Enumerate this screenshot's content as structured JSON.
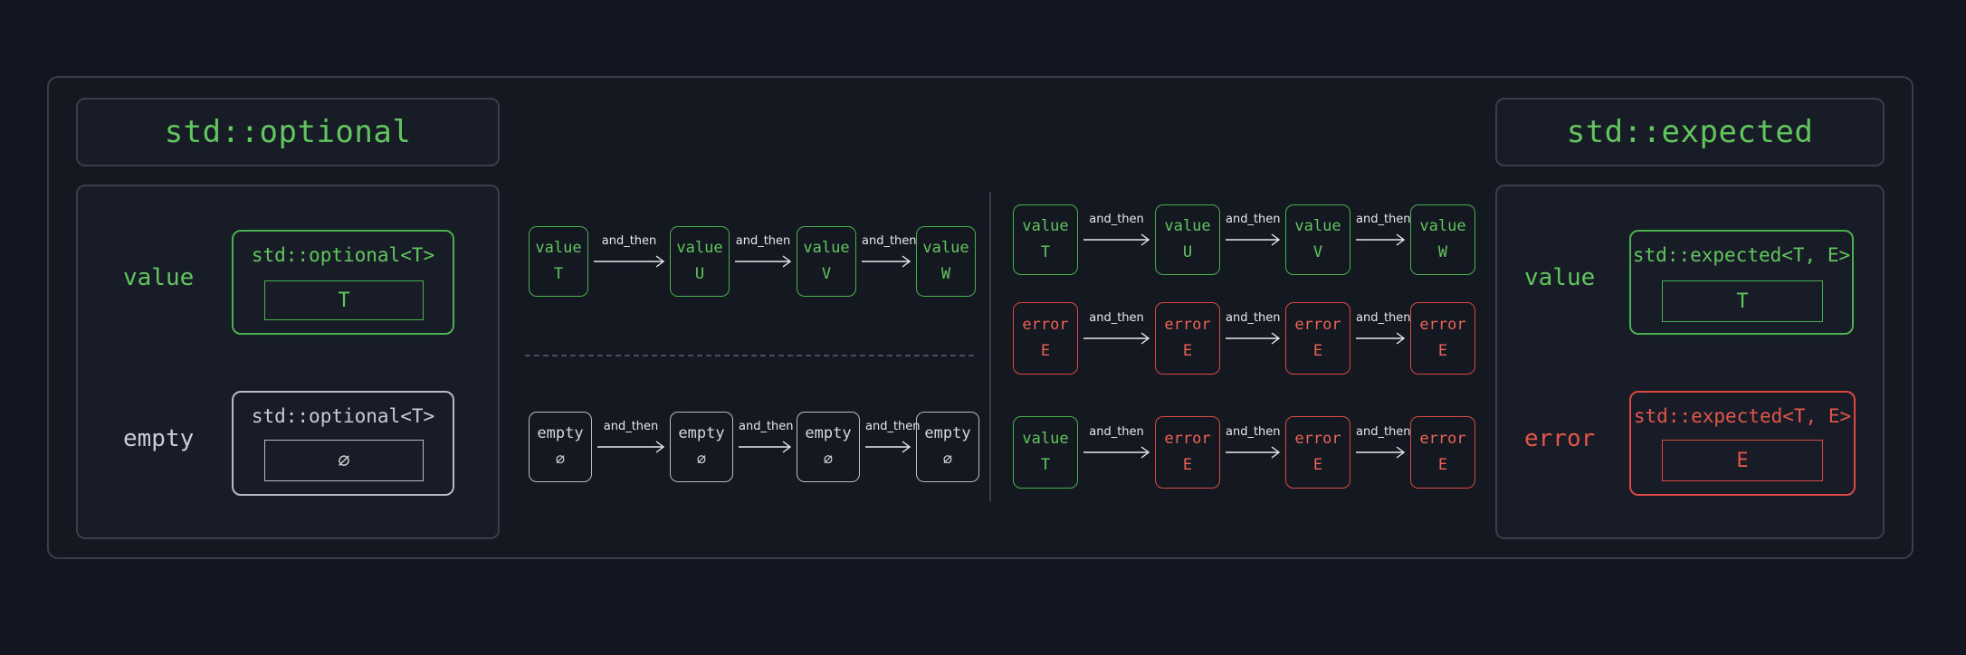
{
  "optional_panel": {
    "title": "std::optional",
    "value_label": "value",
    "empty_label": "empty",
    "value_type": "std::optional<T>",
    "value_inner": "T",
    "empty_type": "std::optional<T>",
    "empty_inner": "∅"
  },
  "expected_panel": {
    "title": "std::expected",
    "value_label": "value",
    "error_label": "error",
    "value_type": "std::expected<T, E>",
    "value_inner": "T",
    "error_type": "std::expected<T, E>",
    "error_inner": "E"
  },
  "arrow_label": "and_then",
  "chains": {
    "optional_value": [
      {
        "top": "value",
        "bottom": "T",
        "kind": "green"
      },
      {
        "top": "value",
        "bottom": "U",
        "kind": "green"
      },
      {
        "top": "value",
        "bottom": "V",
        "kind": "green"
      },
      {
        "top": "value",
        "bottom": "W",
        "kind": "green"
      }
    ],
    "optional_empty": [
      {
        "top": "empty",
        "bottom": "∅",
        "kind": "white"
      },
      {
        "top": "empty",
        "bottom": "∅",
        "kind": "white"
      },
      {
        "top": "empty",
        "bottom": "∅",
        "kind": "white"
      },
      {
        "top": "empty",
        "bottom": "∅",
        "kind": "white"
      }
    ],
    "expected_value": [
      {
        "top": "value",
        "bottom": "T",
        "kind": "green"
      },
      {
        "top": "value",
        "bottom": "U",
        "kind": "green"
      },
      {
        "top": "value",
        "bottom": "V",
        "kind": "green"
      },
      {
        "top": "value",
        "bottom": "W",
        "kind": "green"
      }
    ],
    "expected_error": [
      {
        "top": "error",
        "bottom": "E",
        "kind": "red"
      },
      {
        "top": "error",
        "bottom": "E",
        "kind": "red"
      },
      {
        "top": "error",
        "bottom": "E",
        "kind": "red"
      },
      {
        "top": "error",
        "bottom": "E",
        "kind": "red"
      }
    ],
    "expected_mixed": [
      {
        "top": "value",
        "bottom": "T",
        "kind": "green"
      },
      {
        "top": "error",
        "bottom": "E",
        "kind": "red"
      },
      {
        "top": "error",
        "bottom": "E",
        "kind": "red"
      },
      {
        "top": "error",
        "bottom": "E",
        "kind": "red"
      }
    ]
  },
  "colors": {
    "green": "#62c55e",
    "red": "#e4564a",
    "white": "#d5d8de",
    "background": "#131620"
  }
}
